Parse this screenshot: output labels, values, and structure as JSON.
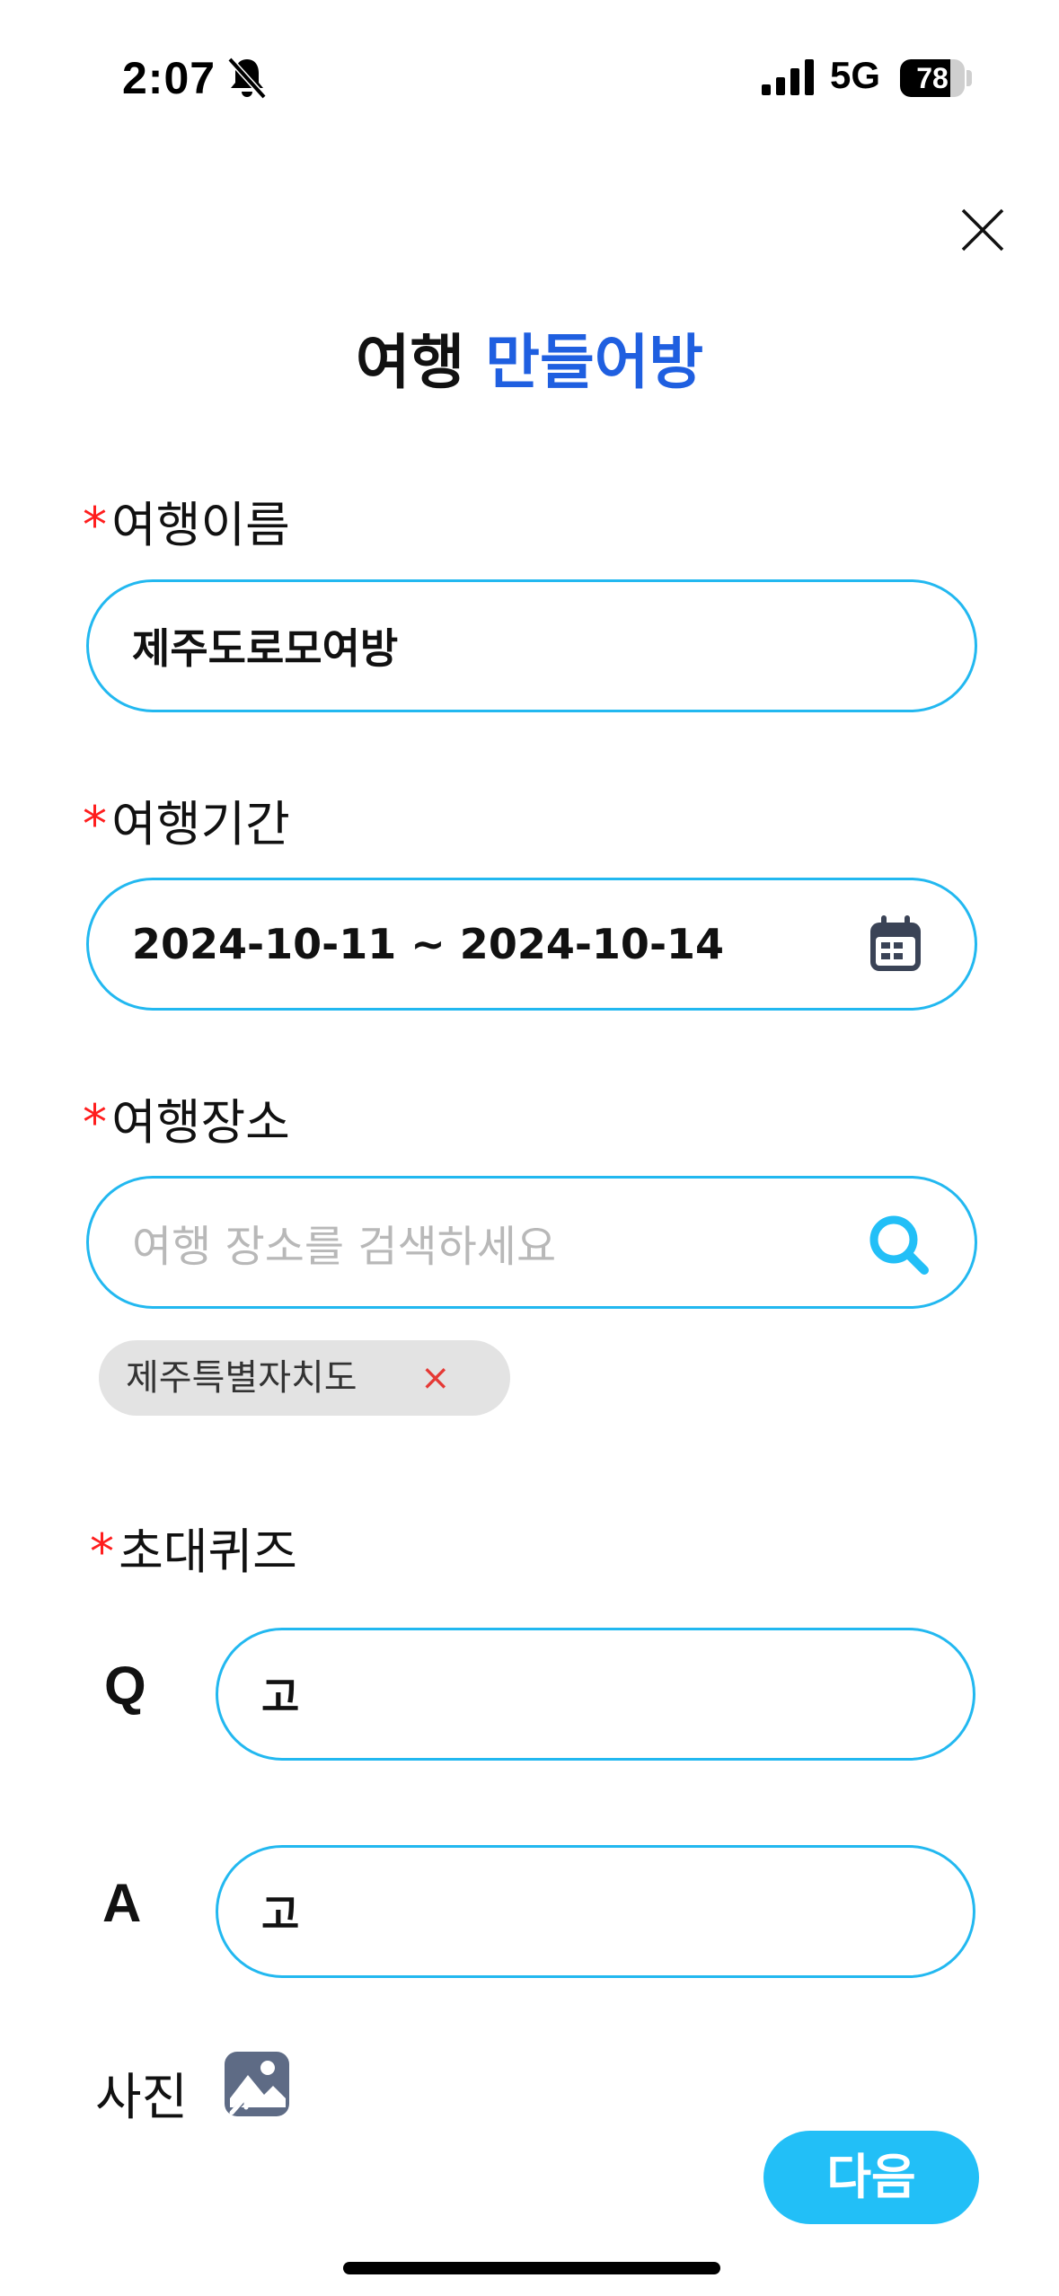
{
  "status_bar": {
    "time": "2:07",
    "network": "5G",
    "battery": "78",
    "battery_level": 0.78
  },
  "header": {
    "title_part1": "여행",
    "title_part2": "만들어방"
  },
  "form": {
    "required_mark": "*",
    "trip_name": {
      "label": "여행이름",
      "value": "제주도로모여방"
    },
    "trip_period": {
      "label": "여행기간",
      "value": "2024-10-11 ~ 2024-10-14"
    },
    "trip_place": {
      "label": "여행장소",
      "placeholder": "여행 장소를 검색하세요",
      "chips": [
        {
          "text": "제주특별자치도",
          "remove": "×"
        }
      ]
    },
    "quiz": {
      "label": "초대퀴즈",
      "q_label": "Q",
      "q_value": "고",
      "a_label": "A",
      "a_value": "고"
    },
    "photo": {
      "label": "사진"
    }
  },
  "actions": {
    "next_label": "다음"
  },
  "colors": {
    "accent": "#22b8f0",
    "title_blue": "#1f5fe0",
    "required": "#ff1e1e",
    "button": "#22bff7"
  }
}
